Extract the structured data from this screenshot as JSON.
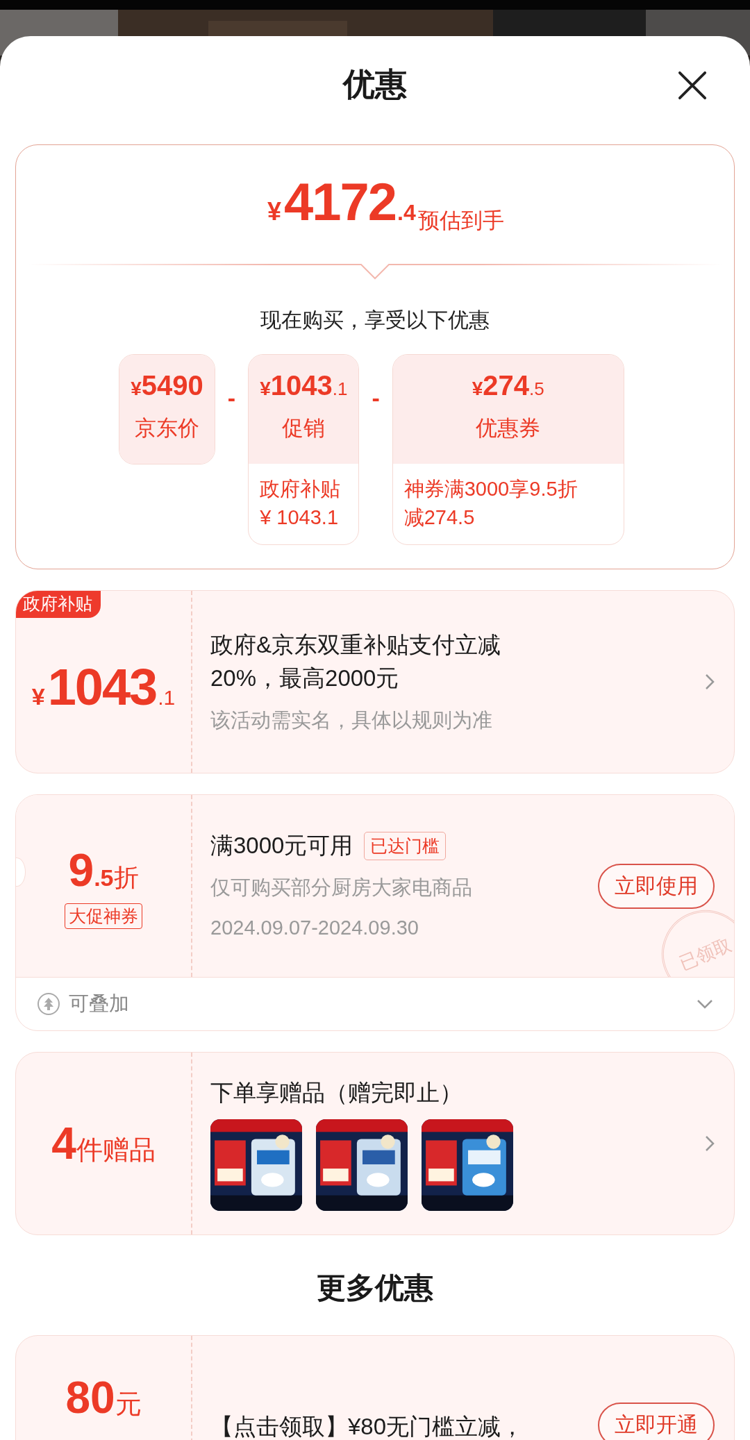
{
  "header": {
    "title": "优惠"
  },
  "summary": {
    "currency": "¥",
    "amount": "4172",
    "decimal": ".4",
    "label": "预估到手",
    "subtitle": "现在购买，享受以下优惠",
    "breakdown": [
      {
        "currency": "¥",
        "amount": "5490",
        "label": "京东价"
      },
      {
        "operator": "-",
        "currency": "¥",
        "amount": "1043",
        "decimal": ".1",
        "label": "促销",
        "detail": "政府补贴\n¥ 1043.1"
      },
      {
        "operator": "-",
        "currency": "¥",
        "amount": "274",
        "decimal": ".5",
        "label": "优惠券",
        "detail": "神券满3000享9.5折减274.5"
      }
    ]
  },
  "offers": [
    {
      "kind": "subsidy",
      "badge": "政府补贴",
      "currency": "¥",
      "amount": "1043",
      "decimal": ".1",
      "title": "政府&京东双重补贴支付立减20%，最高2000元",
      "note": "该活动需实名，具体以规则为准"
    },
    {
      "kind": "coupon",
      "amount": "9",
      "decimal": ".5",
      "unit": "折",
      "tag": "大促神券",
      "title": "满3000元可用",
      "status_tag": "已达门槛",
      "scope": "仅可购买部分厨房大家电商品",
      "period": "2024.09.07-2024.09.30",
      "action": "立即使用",
      "stamp": "已领取",
      "stackable": "可叠加",
      "expanded": false
    },
    {
      "kind": "gift",
      "amount": "4",
      "unit": "件赠品",
      "title": "下单享赠品（赠完即止）"
    }
  ],
  "more_offers": {
    "title": "更多优惠",
    "items": [
      {
        "kind": "cash",
        "amount": "80",
        "unit": "元",
        "title": "【点击领取】¥80无门槛立减，",
        "action": "立即开通"
      }
    ]
  }
}
